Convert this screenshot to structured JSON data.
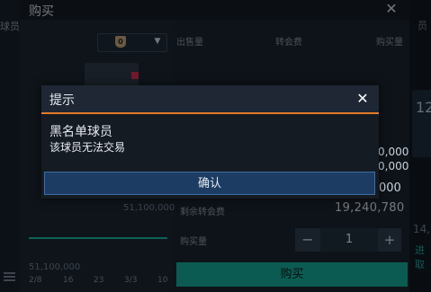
{
  "window": {
    "title": "购买",
    "close_icon": "close-icon"
  },
  "background": {
    "left_tab": "球员",
    "right_tab": "员",
    "right_card_text": "12",
    "right_num": "14,",
    "right_link": "进取"
  },
  "filter": {
    "badge": "0"
  },
  "table": {
    "headers": [
      "出售量",
      "转会费",
      "购买量"
    ],
    "peek_values": [
      "0,000",
      "0,000",
      "000"
    ]
  },
  "left": {
    "price_top": "51,100,000",
    "price_bottom": "51,100,000",
    "pager": [
      "2/8",
      "16",
      "23",
      "3/3",
      "10"
    ]
  },
  "summary": {
    "remain_label": "剩余转会费",
    "remain_value": "19,240,780",
    "quantity_label": "购买量",
    "quantity_value": "1",
    "minus": "−",
    "plus": "+",
    "buy_label": "购买"
  },
  "dialog": {
    "title": "提示",
    "heading": "黑名单球员",
    "message": "该球员无法交易",
    "confirm_label": "确认"
  },
  "colors": {
    "accent_teal": "#14a695",
    "dialog_divider": "#e07a27",
    "confirm_bg": "#1d3c64"
  }
}
